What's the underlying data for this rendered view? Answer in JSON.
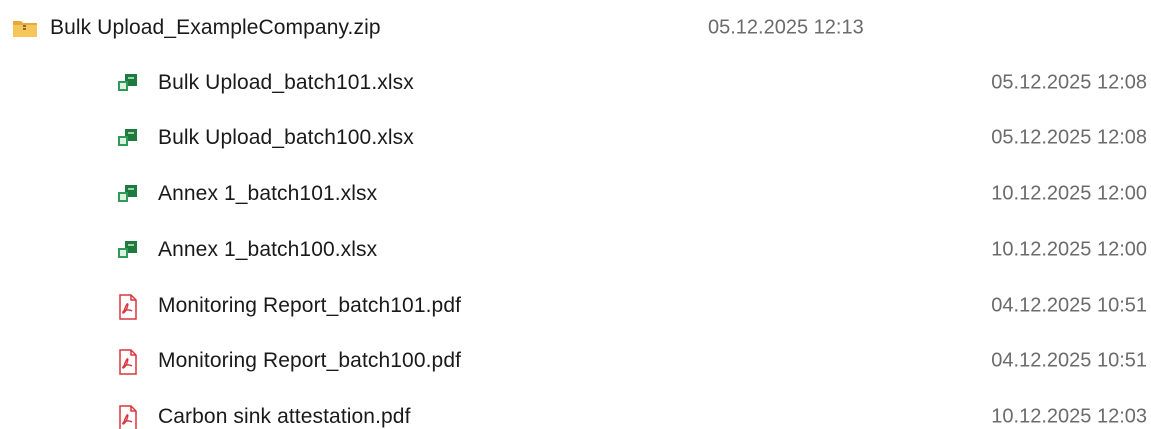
{
  "folder": {
    "name": "Bulk Upload_ExampleCompany.zip",
    "date": "05.12.2025 12:13",
    "icon": "zip-folder-icon"
  },
  "files": [
    {
      "name": "Bulk Upload_batch101.xlsx",
      "date": "05.12.2025 12:08",
      "type": "xlsx",
      "icon": "excel-file-icon"
    },
    {
      "name": "Bulk Upload_batch100.xlsx",
      "date": "05.12.2025 12:08",
      "type": "xlsx",
      "icon": "excel-file-icon"
    },
    {
      "name": "Annex 1_batch101.xlsx",
      "date": "10.12.2025 12:00",
      "type": "xlsx",
      "icon": "excel-file-icon"
    },
    {
      "name": "Annex 1_batch100.xlsx",
      "date": "10.12.2025 12:00",
      "type": "xlsx",
      "icon": "excel-file-icon"
    },
    {
      "name": "Monitoring Report_batch101.pdf",
      "date": "04.12.2025 10:51",
      "type": "pdf",
      "icon": "pdf-file-icon"
    },
    {
      "name": "Monitoring Report_batch100.pdf",
      "date": "04.12.2025 10:51",
      "type": "pdf",
      "icon": "pdf-file-icon"
    },
    {
      "name": "Carbon sink attestation.pdf",
      "date": "10.12.2025 12:03",
      "type": "pdf",
      "icon": "pdf-file-icon"
    }
  ],
  "colors": {
    "folder": "#f2c14e",
    "excel": "#1f7a3f",
    "pdf": "#d9363e",
    "date_text": "#6b6b6b"
  }
}
